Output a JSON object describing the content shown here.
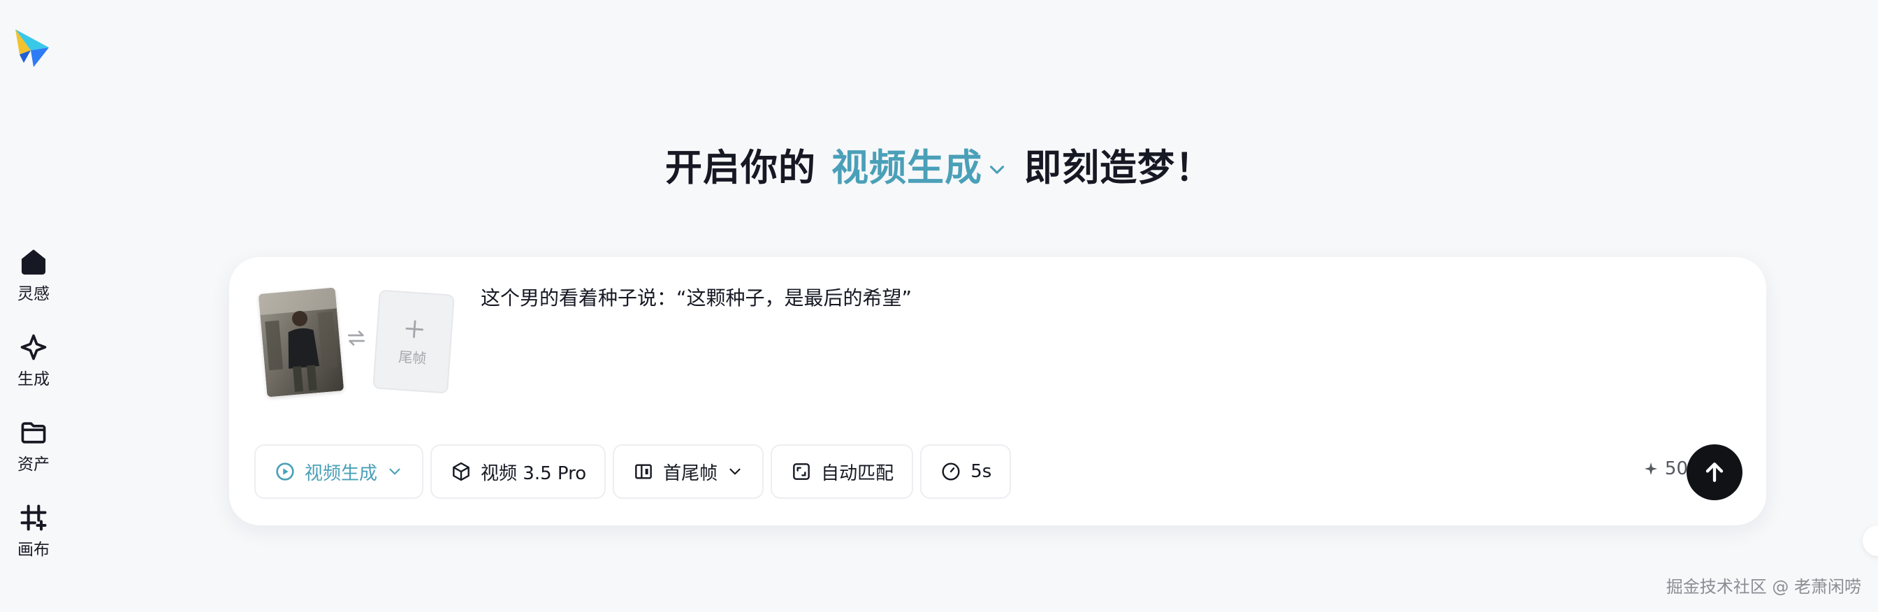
{
  "app": {
    "logo_icon": "paper-plane-logo",
    "brand_colors": {
      "blue": "#2e7bf6",
      "cyan": "#38c8e8",
      "yellow": "#f2c230",
      "accent_text": "#4aa0b8"
    }
  },
  "sidebar": {
    "items": [
      {
        "label": "灵感",
        "icon": "home-icon"
      },
      {
        "label": "生成",
        "icon": "sparkle-icon"
      },
      {
        "label": "资产",
        "icon": "folder-icon"
      },
      {
        "label": "画布",
        "icon": "canvas-grid-icon"
      }
    ]
  },
  "header": {
    "prefix": "开启你的",
    "mode": "视频生成",
    "suffix": "即刻造梦！"
  },
  "composer": {
    "first_frame_image": "man-in-dark-jacket-photo",
    "last_frame_label": "尾帧",
    "prompt": "这个男的看着种子说：“这颗种子，是最后的希望”",
    "toolbar": {
      "mode": "视频生成",
      "model": "视频 3.5 Pro",
      "frame_mode": "首尾帧",
      "aspect": "自动匹配",
      "duration": "5s"
    },
    "credits": "50"
  },
  "watermark": "掘金技术社区 @ 老萧闲唠"
}
